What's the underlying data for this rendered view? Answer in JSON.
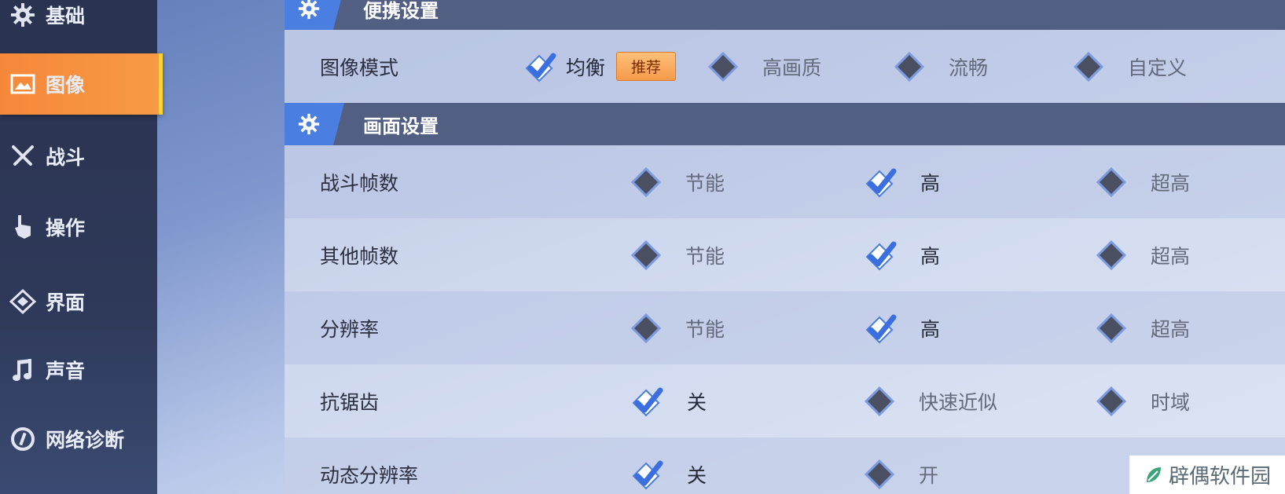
{
  "sidebar": {
    "items": [
      {
        "label": "基础",
        "icon": "gear-icon"
      },
      {
        "label": "图像",
        "icon": "image-icon",
        "active": true
      },
      {
        "label": "战斗",
        "icon": "crossed-swords-icon"
      },
      {
        "label": "操作",
        "icon": "pointing-hand-icon"
      },
      {
        "label": "界面",
        "icon": "interface-icon"
      },
      {
        "label": "声音",
        "icon": "music-note-icon"
      },
      {
        "label": "网络诊断",
        "icon": "network-icon"
      }
    ]
  },
  "sections": {
    "portable": {
      "title": "便携设置",
      "rows": [
        {
          "label": "图像模式",
          "options": [
            {
              "label": "均衡",
              "checked": true,
              "badge": "推荐"
            },
            {
              "label": "高画质",
              "checked": false
            },
            {
              "label": "流畅",
              "checked": false
            },
            {
              "label": "自定义",
              "checked": false
            }
          ]
        }
      ]
    },
    "display": {
      "title": "画面设置",
      "rows": [
        {
          "label": "战斗帧数",
          "options": [
            {
              "label": "节能",
              "checked": false
            },
            {
              "label": "高",
              "checked": true
            },
            {
              "label": "超高",
              "checked": false
            }
          ]
        },
        {
          "label": "其他帧数",
          "options": [
            {
              "label": "节能",
              "checked": false
            },
            {
              "label": "高",
              "checked": true
            },
            {
              "label": "超高",
              "checked": false
            }
          ]
        },
        {
          "label": "分辨率",
          "options": [
            {
              "label": "节能",
              "checked": false
            },
            {
              "label": "高",
              "checked": true
            },
            {
              "label": "超高",
              "checked": false
            }
          ]
        },
        {
          "label": "抗锯齿",
          "options": [
            {
              "label": "关",
              "checked": true
            },
            {
              "label": "快速近似",
              "checked": false
            },
            {
              "label": "时域",
              "checked": false
            }
          ]
        },
        {
          "label": "动态分辨率",
          "options": [
            {
              "label": "关",
              "checked": true
            },
            {
              "label": "开",
              "checked": false
            }
          ]
        }
      ]
    }
  },
  "watermark": {
    "text": "辟偶软件园"
  },
  "colors": {
    "active_tab": "#f6883a",
    "accent_blue": "#4a7ee0",
    "header_bg": "#525f83",
    "sidebar_bg": "#2a3350"
  }
}
